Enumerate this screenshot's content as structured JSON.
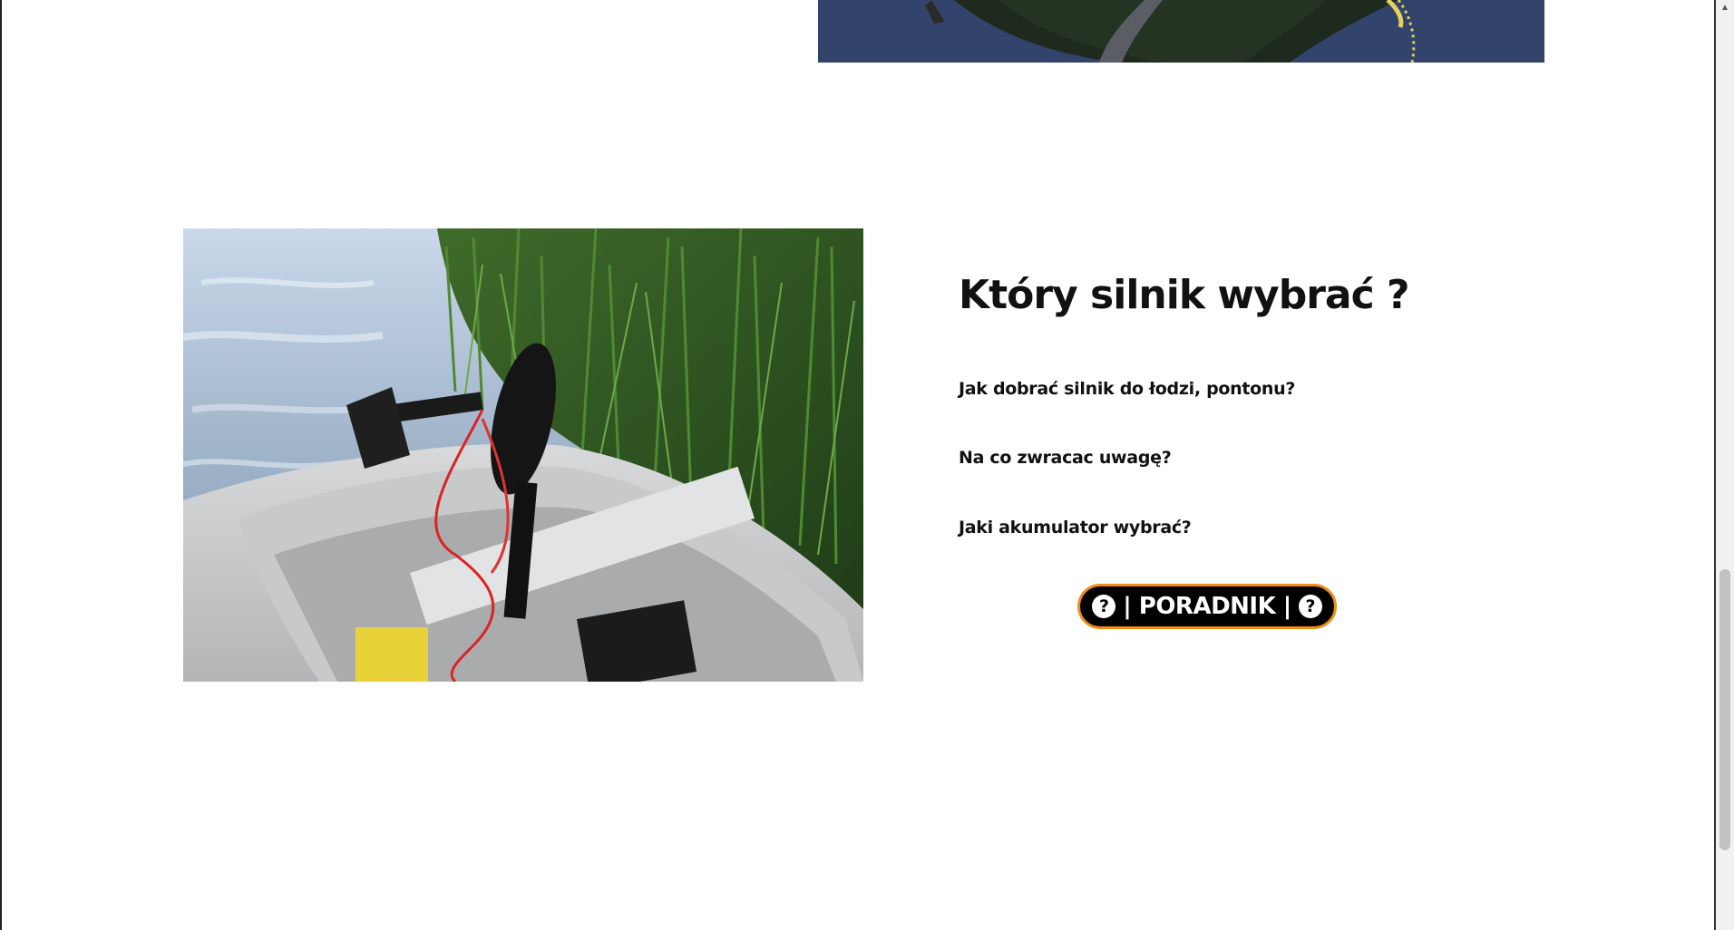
{
  "page": {
    "background": "#ffffff"
  },
  "top_image": {
    "icon": "lake-boat-photo-icon"
  },
  "section": {
    "photo_icon": "boat-electric-motor-photo-icon",
    "title": "Który silnik wybrać ?",
    "questions": [
      "Jak dobrać silnik do łodzi, pontonu?",
      "Na co zwracac uwagę?",
      "Jaki akumulator wybrać?"
    ],
    "button": {
      "label": "| PORADNIK |",
      "icon": "question-circle-icon",
      "icon_glyph": "?",
      "border_color": "#f28c18",
      "background": "#000000"
    }
  },
  "scrollbar": {
    "up_arrow": "▲"
  }
}
